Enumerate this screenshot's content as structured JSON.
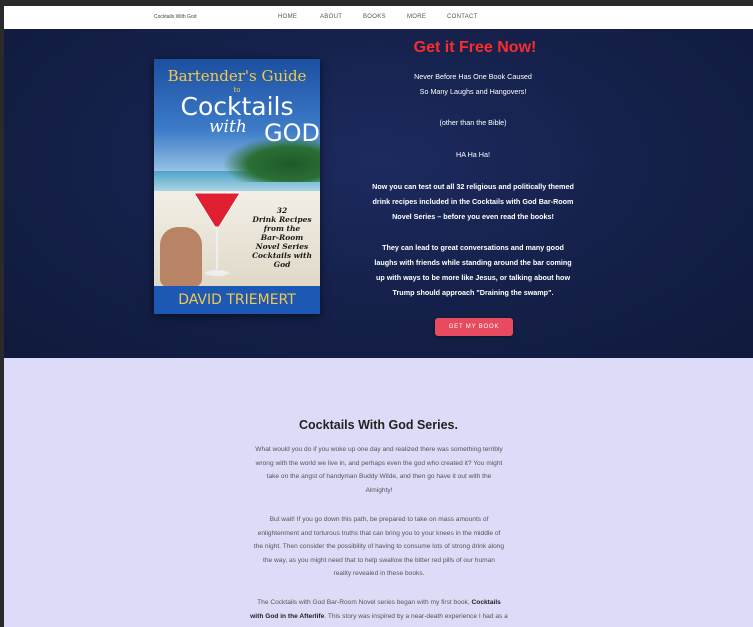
{
  "header": {
    "brand": "Cocktails With God",
    "nav": [
      "HOME",
      "ABOUT",
      "BOOKS",
      "MORE",
      "CONTACT"
    ]
  },
  "hero": {
    "title": "Get it Free Now!",
    "line1": "Never Before Has One Book Caused",
    "line2": "So Many Laughs and Hangovers!",
    "line3": "(other than the Bible)",
    "line4": "HA Ha Ha!",
    "para1_l1": "Now you can test out all 32 religious and politically themed",
    "para1_l2": "drink recipes included in the Cocktails with God Bar-Room",
    "para1_l3": "Novel Series –  before you even read the books!",
    "para2_l1": "They can lead to great conversations and many good",
    "para2_l2": "laughs with friends while standing around the bar coming",
    "para2_l3": "up with ways to be more like Jesus, or talking about how",
    "para2_l4": "Trump should approach \"Draining the swamp\".",
    "cta": "GET MY BOOK"
  },
  "book_cover": {
    "line1": "Bartender's Guide",
    "line2": "to",
    "line3": "Cocktails",
    "line4": "with",
    "line5": "GOD",
    "subtitle": [
      "32",
      "Drink Recipes",
      "from the",
      "Bar-Room",
      "Novel Series",
      "Cocktails with God"
    ],
    "author": "DAVID TRIEMERT"
  },
  "content": {
    "title": "Cocktails With God Series.",
    "p1": [
      "What would you do if you woke up one day and realized there was something terribly",
      "wrong with the world we live in, and perhaps even the god who created it? You might",
      "take on the angst of handyman Buddy Wilde, and then go have it out with the",
      "Almighty!"
    ],
    "p2": [
      "But wait! If you go down this path, be prepared to take on mass amounts of",
      "enlightenment and torturous truths that can bring you to your knees in the middle of",
      "the night. Then consider the possibility of having to consume lots of strong drink along",
      "the way, as you might need that to help swallow the bitter red pills of our human",
      "reality revealed in these books."
    ],
    "p3_l1_pre": "The Cocktails with God Bar-Room Novel series began with my first book, ",
    "p3_l1_bold": "Cocktails",
    "p3_l2_bold": "with God in the Afterlife",
    "p3_l2_post": ". This story was inspired by a near-death experience I had as a"
  },
  "colors": {
    "hero_bg": "#141f47",
    "title_red": "#ff2a2a",
    "cta_bg": "#e84a5f",
    "content_bg": "#dcdcf8"
  }
}
